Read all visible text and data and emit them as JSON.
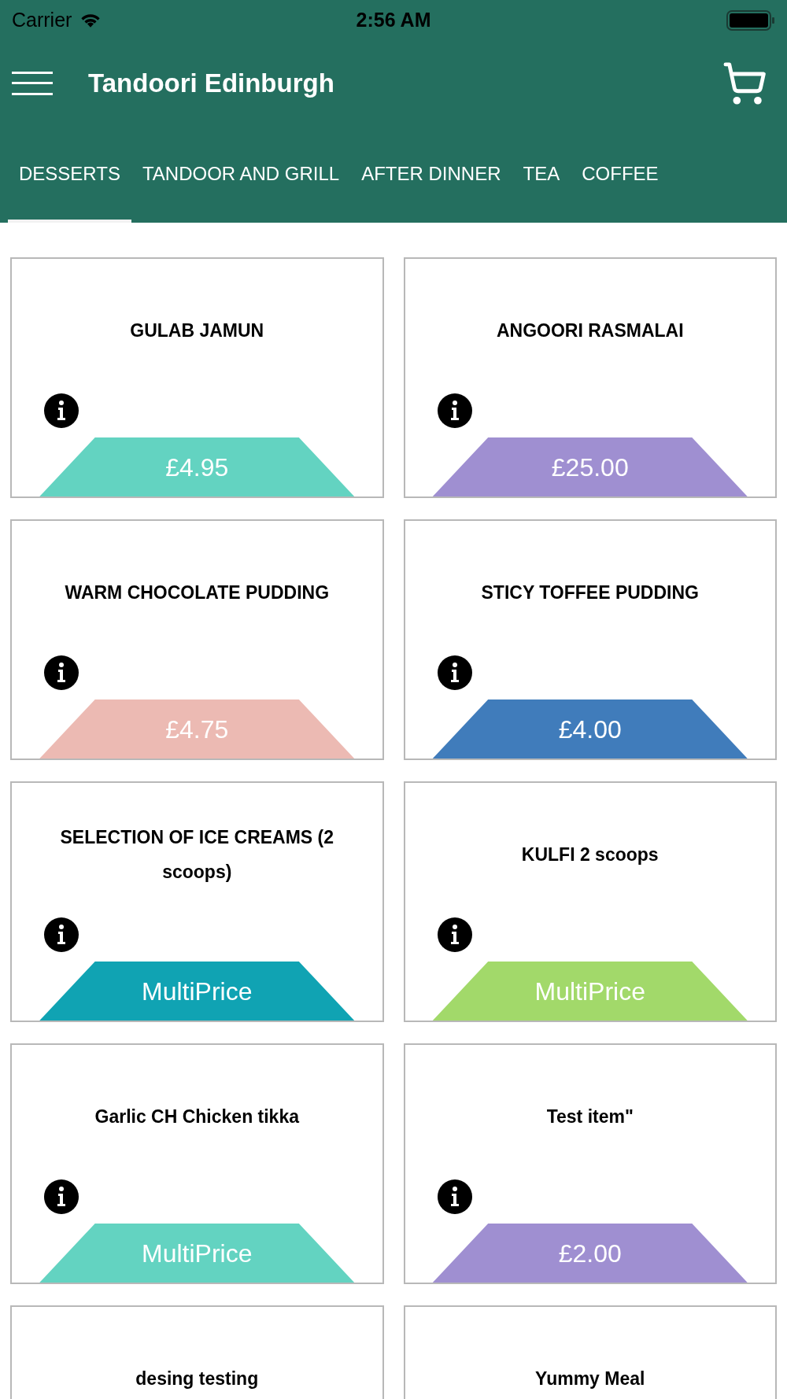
{
  "status_bar": {
    "carrier": "Carrier",
    "time": "2:56 AM"
  },
  "app_bar": {
    "title": "Tandoori Edinburgh"
  },
  "tabs": [
    {
      "label": "DESSERTS",
      "selected": true
    },
    {
      "label": "TANDOOR AND GRILL",
      "selected": false
    },
    {
      "label": "AFTER DINNER",
      "selected": false
    },
    {
      "label": "TEA",
      "selected": false
    },
    {
      "label": "COFFEE",
      "selected": false
    }
  ],
  "items": [
    {
      "name": "GULAB JAMUN",
      "price": "£4.95",
      "color": "#63d3c1"
    },
    {
      "name": "ANGOORI RASMALAI",
      "price": "£25.00",
      "color": "#9f8fd1"
    },
    {
      "name": "WARM CHOCOLATE PUDDING",
      "price": "£4.75",
      "color": "#ecbab3"
    },
    {
      "name": "STICY TOFFEE PUDDING",
      "price": "£4.00",
      "color": "#407cbb"
    },
    {
      "name": "SELECTION OF ICE CREAMS (2 scoops)",
      "price": "MultiPrice",
      "color": "#10a3b3"
    },
    {
      "name": "KULFI 2 scoops",
      "price": "MultiPrice",
      "color": "#a2d96a"
    },
    {
      "name": "Garlic CH Chicken tikka",
      "price": "MultiPrice",
      "color": "#63d3c1"
    },
    {
      "name": "Test item\"",
      "price": "£2.00",
      "color": "#9f8fd1"
    },
    {
      "name": "desing testing"
    },
    {
      "name": "Yummy Meal"
    }
  ]
}
